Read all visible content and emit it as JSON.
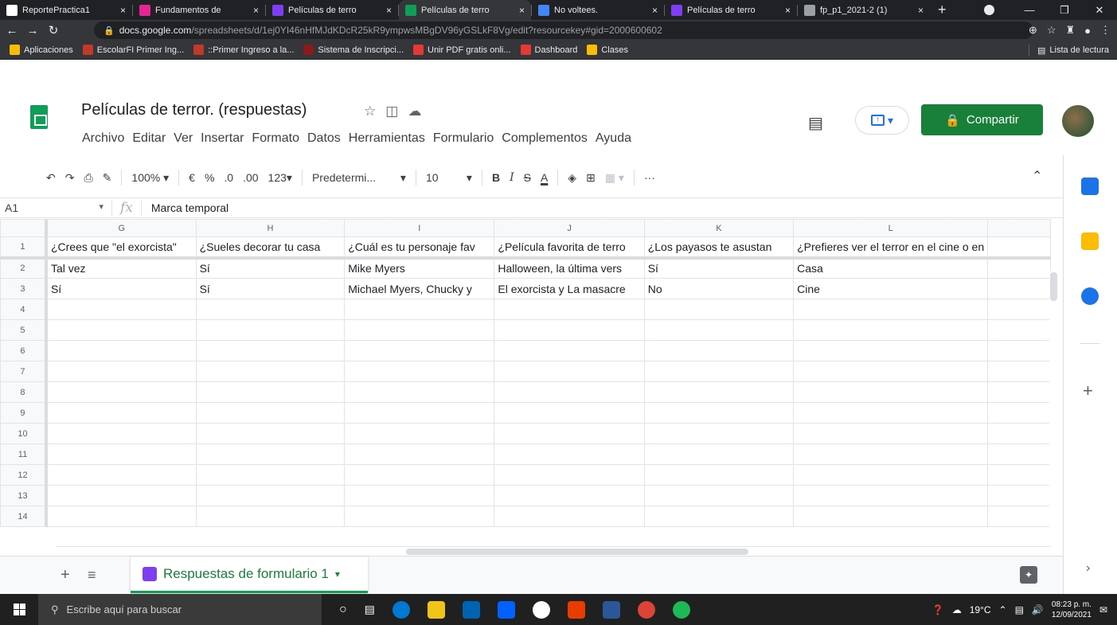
{
  "browser": {
    "tabs": [
      {
        "label": "ReportePractica1",
        "favicon_color": "#ffffff",
        "favicon": "github-icon"
      },
      {
        "label": "Fundamentos de",
        "favicon_color": "#e52592",
        "favicon": "classroom-icon"
      },
      {
        "label": "Películas de terro",
        "favicon_color": "#7e3ff2",
        "favicon": "forms-icon"
      },
      {
        "label": "Películas de terro",
        "favicon_color": "#0f9d58",
        "favicon": "sheets-icon",
        "active": true
      },
      {
        "label": "No voltees.",
        "favicon_color": "#4285f4",
        "favicon": "slides-icon"
      },
      {
        "label": "Películas de terro",
        "favicon_color": "#7e3ff2",
        "favicon": "forms-icon"
      },
      {
        "label": "fp_p1_2021-2 (1)",
        "favicon_color": "#9aa0a6",
        "favicon": "globe-icon"
      }
    ],
    "close_glyph": "×",
    "newtab_glyph": "+",
    "url_host": "docs.google.com",
    "url_path": "/spreadsheets/d/1ej0YI46nHfMJdKDcR25kR9ympwsMBgDV96yGSLkF8Vg/edit?resourcekey#gid=2000600602",
    "bookmarks": [
      {
        "label": "Aplicaciones",
        "color": "#fbbc04"
      },
      {
        "label": "EscolarFI Primer Ing...",
        "color": "#c0392b"
      },
      {
        "label": "::Primer Ingreso a la...",
        "color": "#c0392b"
      },
      {
        "label": "Sistema de Inscripci...",
        "color": "#8b1a1a"
      },
      {
        "label": "Unir PDF gratis onli...",
        "color": "#e53935"
      },
      {
        "label": "Dashboard",
        "color": "#e53935"
      },
      {
        "label": "Clases",
        "color": "#fbbc04"
      }
    ],
    "reading_list": "Lista de lectura"
  },
  "sheet": {
    "title": "Películas de terror. (respuestas)",
    "menu": [
      "Archivo",
      "Editar",
      "Ver",
      "Insertar",
      "Formato",
      "Datos",
      "Herramientas",
      "Formulario",
      "Complementos",
      "Ayuda"
    ],
    "share_label": "Compartir",
    "toolbar": {
      "zoom": "100%",
      "currency": "€",
      "percent": "%",
      "dec_less": ".0",
      "dec_more": ".00",
      "more_formats": "123",
      "font": "Predetermi...",
      "font_size": "10",
      "bold": "B",
      "italic": "I",
      "strike": "S",
      "text_color": "A",
      "more": "···"
    },
    "name_box": "A1",
    "fx": "fx",
    "formula": "Marca temporal",
    "columns": [
      "G",
      "H",
      "I",
      "J",
      "K",
      "L",
      ""
    ],
    "row_numbers": [
      "1",
      "2",
      "3",
      "4",
      "5",
      "6",
      "7",
      "8",
      "9",
      "10",
      "11",
      "12",
      "13",
      "14"
    ],
    "rows": [
      [
        "¿Crees que \"el exorcista\"",
        "¿Sueles decorar tu casa",
        "¿Cuál es tu personaje fav",
        "¿Película favorita de terro",
        "¿Los payasos te asustan",
        "¿Prefieres ver el terror en el cine o en",
        ""
      ],
      [
        "Tal vez",
        "Sí",
        "Mike Myers",
        "Halloween, la última vers",
        "Sí",
        "Casa",
        ""
      ],
      [
        "Sí",
        "Sí",
        "Michael Myers, Chucky y",
        "El exorcista y La masacre",
        "No",
        "Cine",
        ""
      ]
    ],
    "sheet_tab": "Respuestas de formulario 1"
  },
  "taskbar": {
    "search_placeholder": "Escribe aquí para buscar",
    "weather": "19°C",
    "time": "08:23 p. m.",
    "date": "12/09/2021"
  }
}
